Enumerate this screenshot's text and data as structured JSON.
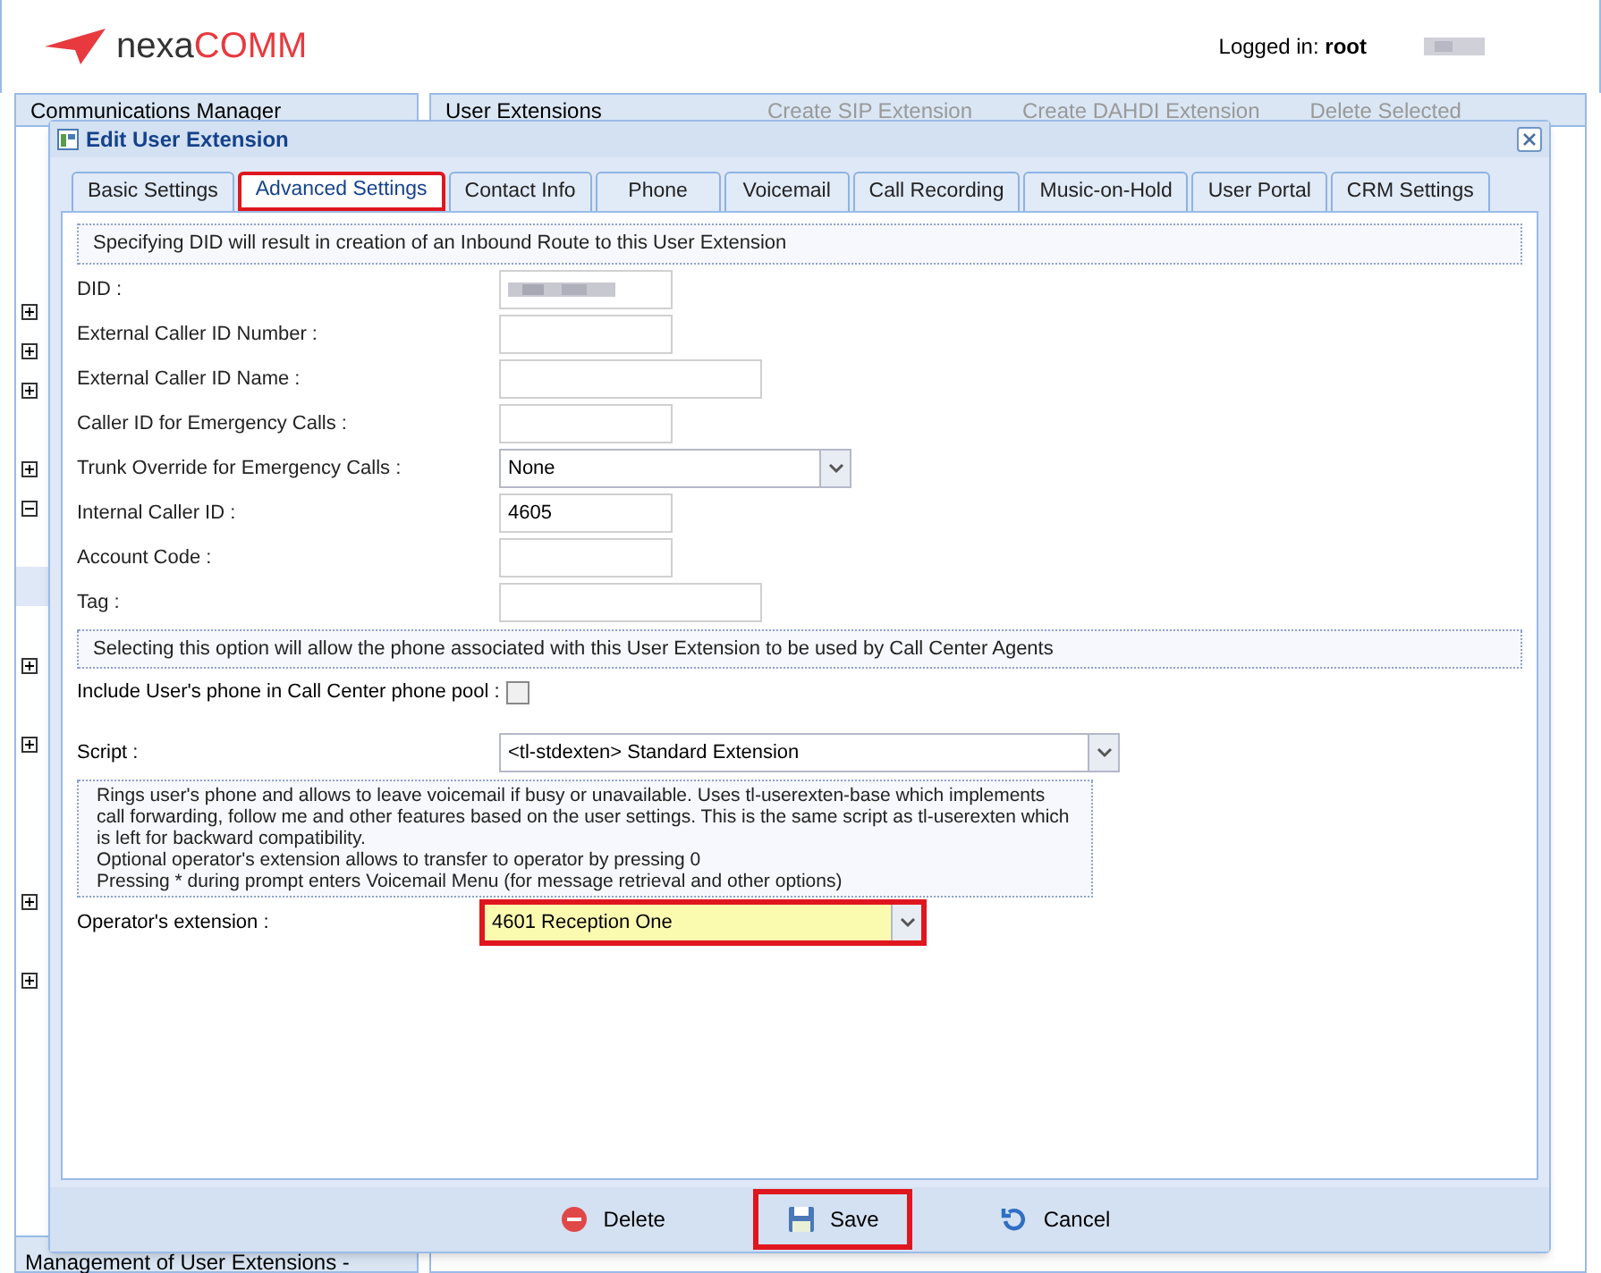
{
  "header": {
    "logo_first": "nexa",
    "logo_second": "COMM",
    "login_label": "Logged in:",
    "login_user": "root"
  },
  "background": {
    "left_panel_title": "Communications Manager",
    "right_panel_title": "User Extensions",
    "toolbar_buttons": [
      "Create SIP Extension",
      "Create DAHDI Extension",
      "Delete Selected"
    ],
    "tree_rows": [
      {
        "expanded": false,
        "selected": false
      },
      {
        "expanded": false,
        "selected": false
      },
      {
        "expanded": false,
        "selected": false
      },
      {
        "selected": false
      },
      {
        "expanded": false,
        "selected": false
      },
      {
        "expanded": true,
        "selected": false
      },
      {
        "selected": false
      },
      {
        "selected": true
      },
      {
        "selected": false
      },
      {
        "expanded": false,
        "selected": false
      },
      {
        "selected": false
      },
      {
        "expanded": false,
        "selected": false
      },
      {
        "selected": false
      },
      {
        "selected": false
      },
      {
        "selected": false
      },
      {
        "expanded": false,
        "selected": false
      },
      {
        "selected": false
      },
      {
        "expanded": false,
        "selected": false
      }
    ],
    "footer_text": "Management of User Extensions -"
  },
  "dialog": {
    "title": "Edit User Extension",
    "tabs": [
      {
        "label": "Basic Settings",
        "selected": false,
        "highlighted": false
      },
      {
        "label": "Advanced Settings",
        "selected": true,
        "highlighted": true
      },
      {
        "label": "Contact Info",
        "selected": false,
        "highlighted": false
      },
      {
        "label": "Phone",
        "selected": false,
        "highlighted": false
      },
      {
        "label": "Voicemail",
        "selected": false,
        "highlighted": false
      },
      {
        "label": "Call Recording",
        "selected": false,
        "highlighted": false
      },
      {
        "label": "Music-on-Hold",
        "selected": false,
        "highlighted": false
      },
      {
        "label": "User Portal",
        "selected": false,
        "highlighted": false
      },
      {
        "label": "CRM Settings",
        "selected": false,
        "highlighted": false
      }
    ],
    "did_note": "Specifying DID will result in creation of an Inbound Route to this User Extension",
    "fields": [
      {
        "kind": "redacted",
        "label": "DID :"
      },
      {
        "kind": "short",
        "label": "External Caller ID Number :"
      },
      {
        "kind": "long",
        "label": "External Caller ID Name :"
      },
      {
        "kind": "short",
        "label": "Caller ID for Emergency Calls :"
      },
      {
        "kind": "select",
        "label": "Trunk Override for Emergency Calls :",
        "value": "None"
      },
      {
        "kind": "short",
        "label": "Internal Caller ID :",
        "value": "4605"
      },
      {
        "kind": "short",
        "label": "Account Code :"
      },
      {
        "kind": "long",
        "label": "Tag :"
      }
    ],
    "call_center_note": "Selecting this option will allow the phone associated with this User Extension to be used by Call Center Agents",
    "pool_checkbox": {
      "label": "Include User's phone in Call Center phone pool :",
      "checked": false
    },
    "script": {
      "label": "Script :",
      "value": "<tl-stdexten> Standard Extension"
    },
    "script_description": [
      "Rings user's phone and allows to leave voicemail if busy or unavailable. Uses tl-userexten-base which implements call forwarding, follow me and other features based on the user settings. This is the same script as tl-userexten which is left for backward compatibility.",
      "Optional operator's extension allows to transfer to operator by pressing 0",
      "Pressing * during prompt enters Voicemail Menu (for message retrieval and other options)"
    ],
    "operator": {
      "label": "Operator's extension :",
      "value": "4601 Reception One",
      "highlighted": true
    },
    "buttons": [
      {
        "kind": "delete",
        "label": "Delete",
        "highlighted": false
      },
      {
        "kind": "save",
        "label": "Save",
        "highlighted": true
      },
      {
        "kind": "cancel",
        "label": "Cancel",
        "highlighted": false
      }
    ]
  }
}
